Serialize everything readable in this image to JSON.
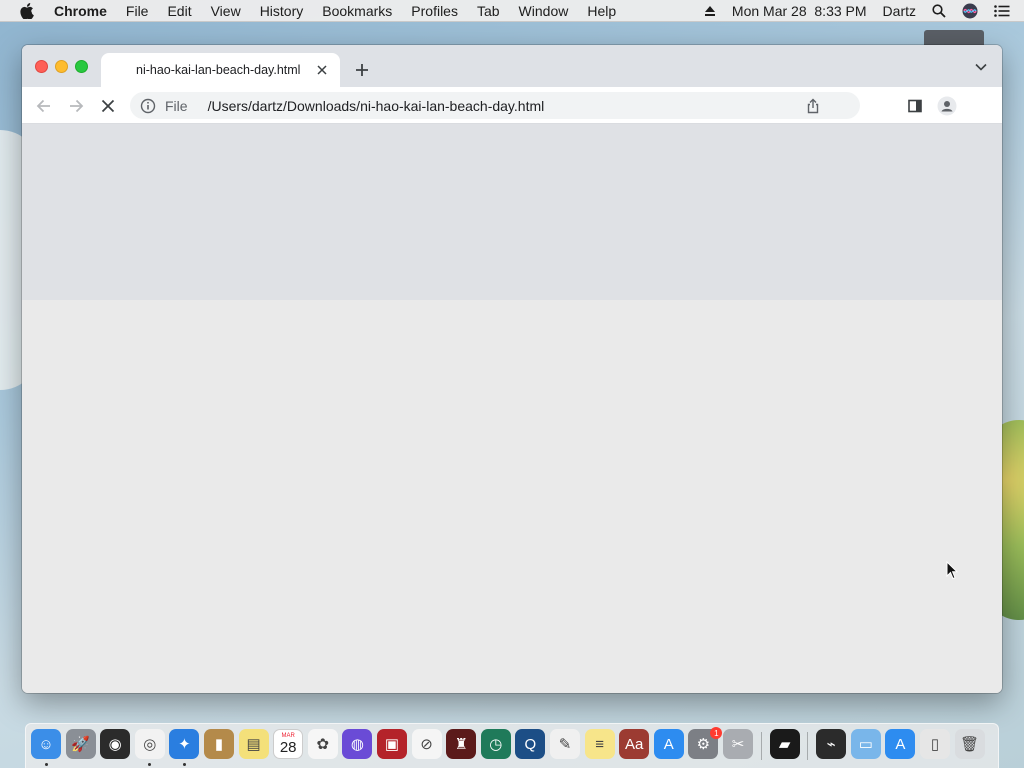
{
  "menubar": {
    "app_name": "Chrome",
    "menus": [
      "File",
      "Edit",
      "View",
      "History",
      "Bookmarks",
      "Profiles",
      "Tab",
      "Window",
      "Help"
    ],
    "datetime": "Mon Mar 28  8:33 PM",
    "user": "Dartz"
  },
  "browser": {
    "tab": {
      "title": "ni-hao-kai-lan-beach-day.html"
    },
    "omnibox": {
      "scheme_label": "File",
      "url": "/Users/dartz/Downloads/ni-hao-kai-lan-beach-day.html"
    },
    "loading": true
  },
  "dock": {
    "calendar_month": "MAR",
    "calendar_day": "28",
    "badges": {
      "system-preferences": "1"
    },
    "items": [
      {
        "name": "finder",
        "color": "#3b8ee8",
        "glyph": "☺",
        "running": true
      },
      {
        "name": "launchpad",
        "color": "#8a8f96",
        "glyph": "🚀",
        "running": false
      },
      {
        "name": "dashboard",
        "color": "#2b2b2b",
        "glyph": "◉",
        "running": false
      },
      {
        "name": "chrome",
        "color": "#f2f2f2",
        "glyph": "◎",
        "running": true
      },
      {
        "name": "safari",
        "color": "#2a7ee0",
        "glyph": "✦",
        "running": true
      },
      {
        "name": "contacts",
        "color": "#b48a4a",
        "glyph": "▮",
        "running": false
      },
      {
        "name": "stickies",
        "color": "#f4e07a",
        "glyph": "▤",
        "running": false
      },
      {
        "name": "calendar",
        "color": "#ffffff",
        "glyph": "",
        "running": false
      },
      {
        "name": "photos",
        "color": "#f6f6f6",
        "glyph": "✿",
        "running": false
      },
      {
        "name": "siri",
        "color": "#6a4bd6",
        "glyph": "◍",
        "running": false
      },
      {
        "name": "photo-booth",
        "color": "#b4232a",
        "glyph": "▣",
        "running": false
      },
      {
        "name": "news",
        "color": "#f5f5f5",
        "glyph": "⊘",
        "running": false
      },
      {
        "name": "chess",
        "color": "#5b1a1a",
        "glyph": "♜",
        "running": false
      },
      {
        "name": "time-machine",
        "color": "#1f7a5a",
        "glyph": "◷",
        "running": false
      },
      {
        "name": "quicktime",
        "color": "#1c4e86",
        "glyph": "Q",
        "running": false
      },
      {
        "name": "textedit",
        "color": "#f0f0f0",
        "glyph": "✎",
        "running": false
      },
      {
        "name": "notes",
        "color": "#f7e58a",
        "glyph": "≡",
        "running": false
      },
      {
        "name": "dictionary",
        "color": "#9c3b32",
        "glyph": "Aa",
        "running": false
      },
      {
        "name": "app-store",
        "color": "#2d8cf0",
        "glyph": "A",
        "running": false
      },
      {
        "name": "system-preferences",
        "color": "#7c7f85",
        "glyph": "⚙",
        "running": false
      },
      {
        "name": "utilities",
        "color": "#a9acb1",
        "glyph": "✂",
        "running": false
      },
      {
        "name": "game-app",
        "color": "#1a1a1a",
        "glyph": "▰",
        "running": false
      },
      {
        "name": "activity-monitor",
        "color": "#2b2b2b",
        "glyph": "⌁",
        "running": false
      },
      {
        "name": "folder",
        "color": "#79b6ea",
        "glyph": "▭",
        "running": false
      },
      {
        "name": "app-store-2",
        "color": "#2d8cf0",
        "glyph": "A",
        "running": false
      },
      {
        "name": "documents",
        "color": "#e6e6e6",
        "glyph": "▯",
        "running": false
      },
      {
        "name": "trash",
        "color": "#d9dcdf",
        "glyph": "🗑",
        "running": false
      }
    ]
  }
}
